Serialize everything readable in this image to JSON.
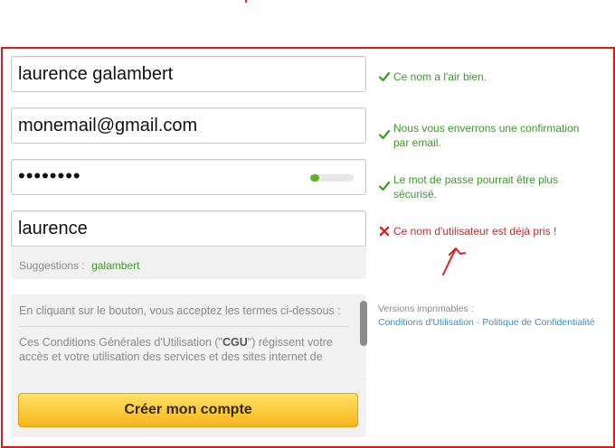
{
  "form": {
    "name_value": "laurence galambert",
    "email_value": "monemail@gmail.com",
    "password_value": "••••••••",
    "password_strength": 0.2,
    "username_value": "laurence"
  },
  "messages": {
    "name_ok": "Ce nom a l'air bien.",
    "email_ok": "Nous vous enverrons une confirmation par email.",
    "password_ok": "Le mot de passe pourrait être plus sécurisé.",
    "username_error": "Ce nom d'utilisateur est déjà pris !"
  },
  "suggestions": {
    "label": "Suggestions :",
    "item": "galambert"
  },
  "terms": {
    "intro": "En cliquant sur le bouton, vous acceptez les termes ci-dessous :",
    "body_prefix": "Ces Conditions Générales d'Utilisation (\"",
    "body_bold": "CGU",
    "body_suffix": "\") régissent votre accès et votre utilisation des services et des sites internet de"
  },
  "create_button_label": "Créer mon compte",
  "printable": {
    "label": "Versions imprimables :",
    "terms_link": "Conditions d'Utilisation",
    "separator": "·",
    "privacy_link": "Politique de Confidentialité"
  },
  "colors": {
    "frame": "#d81c1c",
    "success": "#3a9a26",
    "error": "#cc2a2a",
    "button": "#f8b51d",
    "link": "#3b8fc6"
  },
  "icons": {
    "ok": "check-icon",
    "error": "cross-icon",
    "annotation": "red-arrow-annotation"
  }
}
